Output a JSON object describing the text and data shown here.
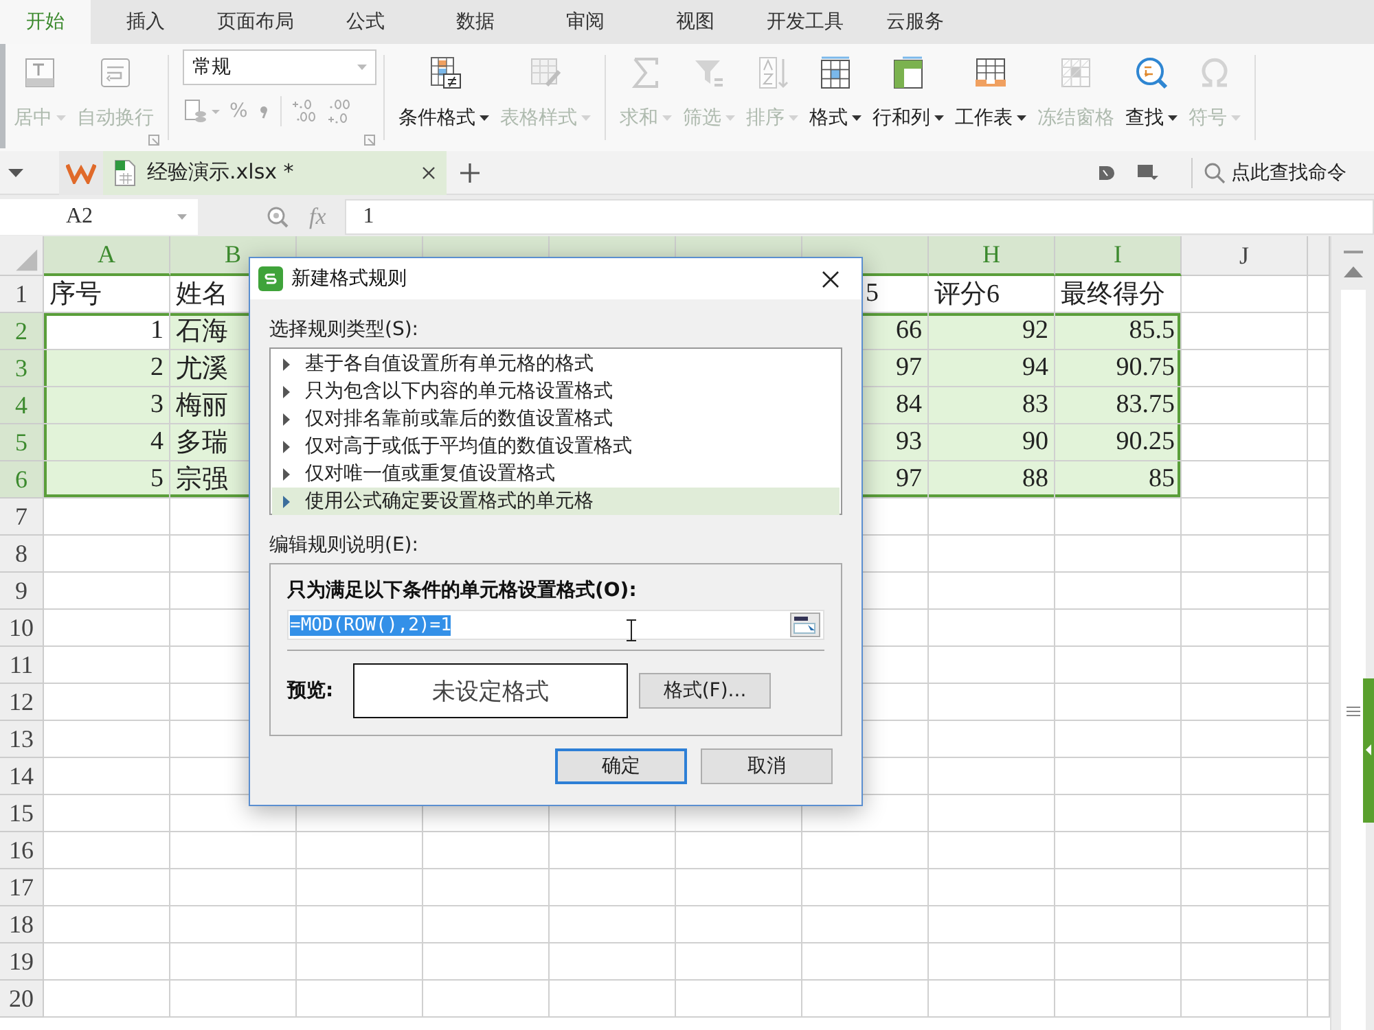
{
  "menu_tabs": [
    {
      "label": "开始",
      "selected": true
    },
    {
      "label": "插入",
      "selected": false
    },
    {
      "label": "页面布局",
      "selected": false
    },
    {
      "label": "公式",
      "selected": false
    },
    {
      "label": "数据",
      "selected": false
    },
    {
      "label": "审阅",
      "selected": false
    },
    {
      "label": "视图",
      "selected": false
    },
    {
      "label": "开发工具",
      "selected": false
    },
    {
      "label": "云服务",
      "selected": false
    }
  ],
  "ribbon": {
    "groups": [
      {
        "kind": "buttons",
        "launcher": true,
        "buttons": [
          {
            "label": "居中",
            "disabled": true,
            "dropdown": true
          },
          {
            "label": "自动换行",
            "disabled": true,
            "dropdown": false
          }
        ]
      },
      {
        "kind": "number",
        "launcher": true,
        "format": "常规",
        "percent": "%"
      },
      {
        "kind": "buttons",
        "buttons": [
          {
            "label": "条件格式",
            "disabled": false,
            "dropdown": true
          },
          {
            "label": "表格样式",
            "disabled": true,
            "dropdown": true
          }
        ]
      },
      {
        "kind": "buttons",
        "buttons": [
          {
            "label": "求和",
            "disabled": true,
            "dropdown": true
          },
          {
            "label": "筛选",
            "disabled": true,
            "dropdown": true
          },
          {
            "label": "排序",
            "disabled": true,
            "dropdown": true
          },
          {
            "label": "格式",
            "disabled": false,
            "dropdown": true
          },
          {
            "label": "行和列",
            "disabled": false,
            "dropdown": true
          },
          {
            "label": "工作表",
            "disabled": false,
            "dropdown": true
          },
          {
            "label": "冻结窗格",
            "disabled": true,
            "dropdown": false
          },
          {
            "label": "查找",
            "disabled": false,
            "dropdown": true
          },
          {
            "label": "符号",
            "disabled": true,
            "dropdown": true
          }
        ]
      }
    ]
  },
  "doc_tabs": [
    {
      "label": "经验演示.xlsx *",
      "selected": true
    }
  ],
  "command_search": {
    "placeholder": "点此查找命令"
  },
  "formula_bar": {
    "name_box": "A2",
    "fx": "fx",
    "value": "1"
  },
  "sheet": {
    "columns": [
      {
        "label": "A",
        "highlighted": true
      },
      {
        "label": "B",
        "highlighted": true
      },
      {
        "highlighted": true
      },
      {
        "highlighted": true
      },
      {
        "highlighted": true
      },
      {
        "highlighted": true
      },
      {
        "highlighted": true
      },
      {
        "label": "H",
        "highlighted": true
      },
      {
        "label": "I",
        "highlighted": true
      },
      {
        "label": "J",
        "highlighted": false
      }
    ],
    "rows": [
      {
        "header": "1",
        "selected": false,
        "cells": [
          {
            "text": "序号",
            "selected": false
          },
          {
            "text": "姓名",
            "selected": false
          },
          null,
          null,
          null,
          null,
          {
            "text": "5",
            "selected": false
          },
          {
            "text": "评分6",
            "selected": false
          },
          {
            "text": "最终得分",
            "selected": false
          }
        ]
      },
      {
        "header": "2",
        "selected": true,
        "cells": [
          {
            "text": "1",
            "selected": false
          },
          {
            "text": "石海",
            "selected": true
          },
          null,
          null,
          null,
          null,
          {
            "text": "66",
            "selected": true
          },
          {
            "text": "92",
            "selected": true
          },
          {
            "text": "85.5",
            "selected": true
          }
        ]
      },
      {
        "header": "3",
        "selected": true,
        "cells": [
          {
            "text": "2",
            "selected": true
          },
          {
            "text": "尤溪",
            "selected": true
          },
          null,
          null,
          null,
          null,
          {
            "text": "97",
            "selected": true
          },
          {
            "text": "94",
            "selected": true
          },
          {
            "text": "90.75",
            "selected": true
          }
        ]
      },
      {
        "header": "4",
        "selected": true,
        "cells": [
          {
            "text": "3",
            "selected": true
          },
          {
            "text": "梅丽",
            "selected": true
          },
          null,
          null,
          null,
          null,
          {
            "text": "84",
            "selected": true
          },
          {
            "text": "83",
            "selected": true
          },
          {
            "text": "83.75",
            "selected": true
          }
        ]
      },
      {
        "header": "5",
        "selected": true,
        "cells": [
          {
            "text": "4",
            "selected": true
          },
          {
            "text": "多瑞",
            "selected": true
          },
          null,
          null,
          null,
          null,
          {
            "text": "93",
            "selected": true
          },
          {
            "text": "90",
            "selected": true
          },
          {
            "text": "90.25",
            "selected": true
          }
        ]
      },
      {
        "header": "6",
        "selected": true,
        "cells": [
          {
            "text": "5",
            "selected": true
          },
          {
            "text": "宗强",
            "selected": true
          },
          null,
          null,
          null,
          null,
          {
            "text": "97",
            "selected": true
          },
          {
            "text": "88",
            "selected": true
          },
          {
            "text": "85",
            "selected": true
          }
        ]
      },
      {
        "header": "7",
        "selected": false
      },
      {
        "header": "8",
        "selected": false
      },
      {
        "header": "9",
        "selected": false
      },
      {
        "header": "10",
        "selected": false
      },
      {
        "header": "11",
        "selected": false
      },
      {
        "header": "12",
        "selected": false
      },
      {
        "header": "13",
        "selected": false
      },
      {
        "header": "14",
        "selected": false
      },
      {
        "header": "15",
        "selected": false
      },
      {
        "header": "16",
        "selected": false
      },
      {
        "header": "17",
        "selected": false
      },
      {
        "header": "18",
        "selected": false
      },
      {
        "header": "19",
        "selected": false
      },
      {
        "header": "20",
        "selected": false
      }
    ]
  },
  "dialog": {
    "title": "新建格式规则",
    "rule_type_label": "选择规则类型(S):",
    "rule_types": [
      {
        "label": "基于各自值设置所有单元格的格式",
        "selected": false
      },
      {
        "label": "只为包含以下内容的单元格设置格式",
        "selected": false
      },
      {
        "label": "仅对排名靠前或靠后的数值设置格式",
        "selected": false
      },
      {
        "label": "仅对高于或低于平均值的数值设置格式",
        "selected": false
      },
      {
        "label": "仅对唯一值或重复值设置格式",
        "selected": false
      },
      {
        "label": "使用公式确定要设置格式的单元格",
        "selected": true
      }
    ],
    "description_label": "编辑规则说明(E):",
    "condition_label": "只为满足以下条件的单元格设置格式(O):",
    "formula": {
      "value": "=MOD(ROW(),2)=1",
      "text_selected": true
    },
    "preview_label": "预览:",
    "preview_text": "未设定格式",
    "format_button": "格式(F)...",
    "buttons": [
      {
        "label": "确定",
        "default": true
      },
      {
        "label": "取消",
        "default": false
      }
    ]
  }
}
